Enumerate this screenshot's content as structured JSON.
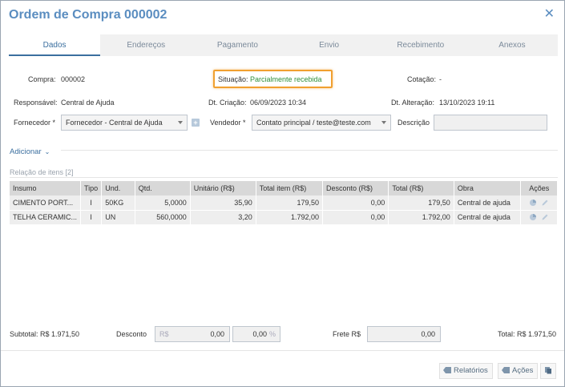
{
  "window": {
    "title": "Ordem de Compra 000002"
  },
  "tabs": [
    "Dados",
    "Endereços",
    "Pagamento",
    "Envio",
    "Recebimento",
    "Anexos"
  ],
  "header": {
    "compra_label": "Compra:",
    "compra_value": "000002",
    "situacao_label": "Situação:",
    "situacao_value": "Parcialmente recebida",
    "cotacao_label": "Cotação:",
    "cotacao_value": "-",
    "responsavel_label": "Responsável:",
    "responsavel_value": "Central de Ajuda",
    "criacao_label": "Dt. Criação:",
    "criacao_value": "06/09/2023 10:34",
    "alteracao_label": "Dt. Alteração:",
    "alteracao_value": "13/10/2023 19:11",
    "fornecedor_label": "Fornecedor *",
    "fornecedor_value": "Fornecedor - Central de Ajuda",
    "vendedor_label": "Vendedor *",
    "vendedor_value": "Contato principal / teste@teste.com",
    "descricao_label": "Descrição",
    "descricao_value": ""
  },
  "adicionar_label": "Adicionar",
  "items_section_title": "Relação de itens [2]",
  "table": {
    "headers": [
      "Insumo",
      "Tipo",
      "Und.",
      "Qtd.",
      "Unitário (R$)",
      "Total item (R$)",
      "Desconto (R$)",
      "Total (R$)",
      "Obra",
      "Ações"
    ],
    "rows": [
      [
        "CIMENTO PORT...",
        "I",
        "50KG",
        "5,0000",
        "35,90",
        "179,50",
        "0,00",
        "179,50",
        "Central de ajuda"
      ],
      [
        "TELHA CERAMIC...",
        "I",
        "UN",
        "560,0000",
        "3,20",
        "1.792,00",
        "0,00",
        "1.792,00",
        "Central de ajuda"
      ]
    ]
  },
  "totals": {
    "subtotal": "Subtotal: R$ 1.971,50",
    "desconto_label": "Desconto",
    "desconto_prefix": "R$",
    "desconto_value": "0,00",
    "desconto_pct": "0,00",
    "pct_suffix": "%",
    "frete_label": "Frete R$",
    "frete_value": "0,00",
    "total": "Total: R$ 1.971,50"
  },
  "footer": {
    "relatorios": "Relatórios",
    "acoes": "Ações"
  },
  "colors": {
    "accent": "#5a8dc0",
    "status": "#2f8f3a",
    "highlight": "#f0a030"
  }
}
